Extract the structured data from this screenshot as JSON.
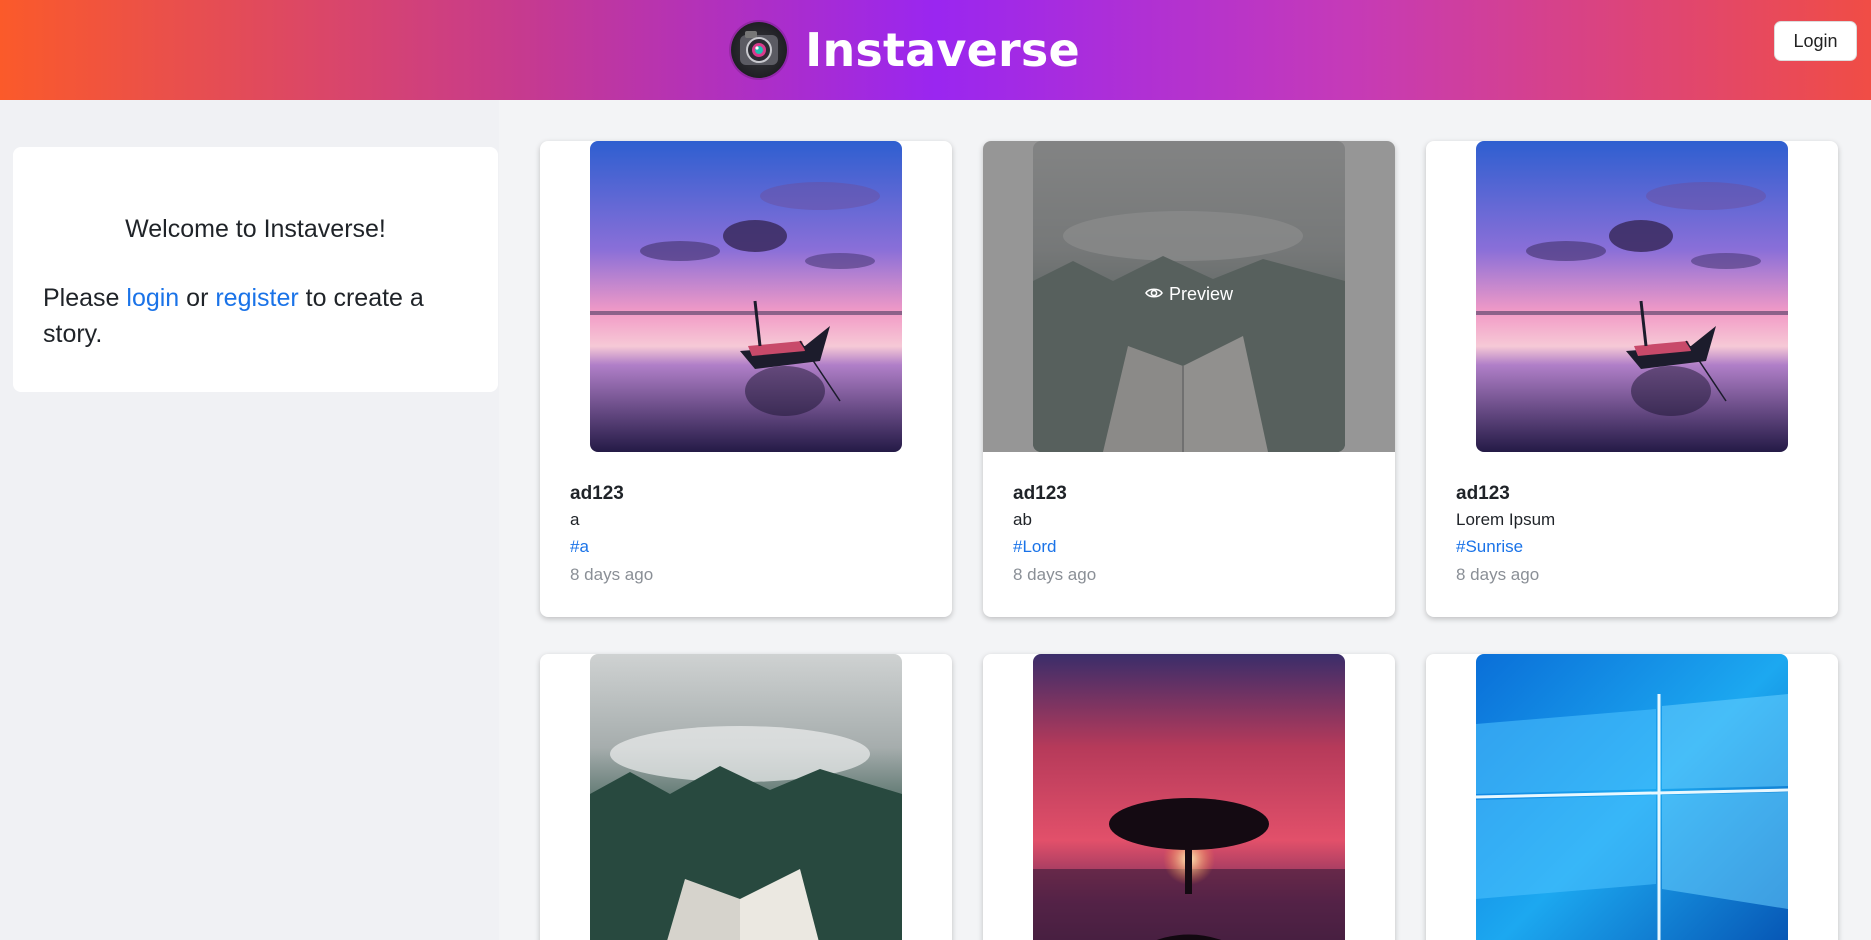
{
  "header": {
    "title": "Instaverse",
    "logo_icon": "camera-lens-icon",
    "login_label": "Login",
    "gradient_colors": [
      "#fb5a2a",
      "#9a26f0",
      "#f04d45"
    ]
  },
  "sidebar": {
    "welcome_title": "Welcome to Instaverse!",
    "text_before": "Please ",
    "login_link": "login",
    "text_middle": " or ",
    "register_link": "register",
    "text_after": " to create a story."
  },
  "posts": [
    {
      "user": "ad123",
      "caption": "a",
      "tag": "#a",
      "time": "8 days ago",
      "image": "sunset-lake-boat"
    },
    {
      "user": "ad123",
      "caption": "ab",
      "tag": "#Lord",
      "time": "8 days ago",
      "image": "misty-forest-book",
      "hover_label": "Preview"
    },
    {
      "user": "ad123",
      "caption": "Lorem Ipsum",
      "tag": "#Sunrise",
      "time": "8 days ago",
      "image": "sunset-lake-boat"
    },
    {
      "image": "misty-forest-book"
    },
    {
      "image": "red-sky-tree"
    },
    {
      "image": "windows-logo-blue"
    }
  ],
  "colors": {
    "link": "#1a73e8",
    "muted": "#8a8f96"
  }
}
